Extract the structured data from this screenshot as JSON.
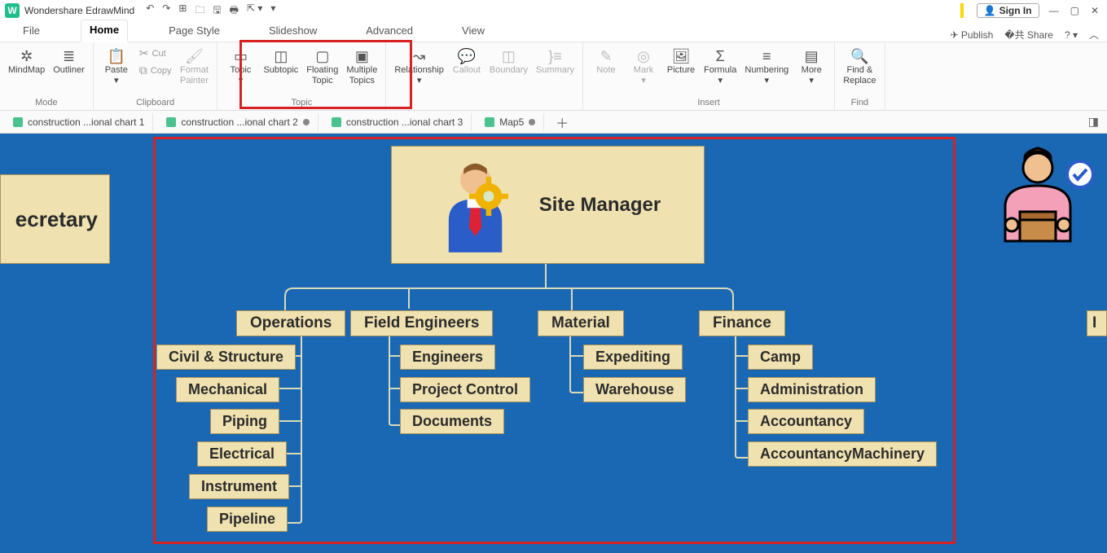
{
  "app": {
    "title": "Wondershare EdrawMind"
  },
  "titlebar": {
    "signin": "Sign In"
  },
  "menu": {
    "file": "File",
    "home": "Home",
    "page_style": "Page Style",
    "slideshow": "Slideshow",
    "advanced": "Advanced",
    "view": "View",
    "publish": "Publish",
    "share": "Share"
  },
  "ribbon": {
    "mindmap": "MindMap",
    "outliner": "Outliner",
    "mode": "Mode",
    "paste": "Paste",
    "cut": "Cut",
    "copy": "Copy",
    "format_painter1": "Format",
    "format_painter2": "Painter",
    "clipboard": "Clipboard",
    "topic": "Topic",
    "subtopic": "Subtopic",
    "floating1": "Floating",
    "floating2": "Topic",
    "multiple1": "Multiple",
    "multiple2": "Topics",
    "topic_group": "Topic",
    "relationship": "Relationship",
    "callout": "Callout",
    "boundary": "Boundary",
    "summary": "Summary",
    "note": "Note",
    "mark": "Mark",
    "picture": "Picture",
    "formula": "Formula",
    "numbering": "Numbering",
    "more": "More",
    "insert": "Insert",
    "find1": "Find &",
    "find2": "Replace",
    "find_group": "Find"
  },
  "tabs": {
    "t1": "construction ...ional chart 1",
    "t2": "construction ...ional chart 2",
    "t3": "construction ...ional chart 3",
    "t4": "Map5"
  },
  "chart": {
    "root": "Site Manager",
    "secretary": "ecretary",
    "side_right": "I",
    "operations": "Operations",
    "ops": {
      "a": "Civil & Structure",
      "b": "Mechanical",
      "c": "Piping",
      "d": "Electrical",
      "e": "Instrument",
      "f": "Pipeline"
    },
    "field": "Field Engineers",
    "fld": {
      "a": "Engineers",
      "b": "Project Control",
      "c": "Documents"
    },
    "material": "Material",
    "mat": {
      "a": "Expediting",
      "b": "Warehouse"
    },
    "finance": "Finance",
    "fin": {
      "a": "Camp",
      "b": "Administration",
      "c": "Accountancy",
      "d": "AccountancyMachinery"
    }
  }
}
